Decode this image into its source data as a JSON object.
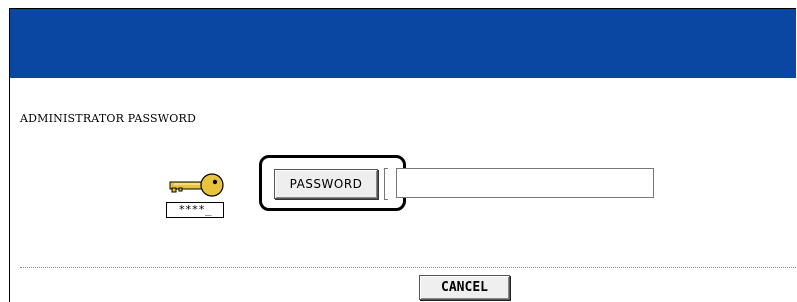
{
  "header": {
    "banner_color": "#0a47a2"
  },
  "section": {
    "title": "ADMINISTRATOR PASSWORD"
  },
  "key_icon": {
    "name": "key-icon",
    "masked_text": "****_",
    "key_color": "#e8c43c"
  },
  "password": {
    "button_label": "PASSWORD",
    "field_value": ""
  },
  "footer": {
    "cancel_label": "CANCEL"
  }
}
